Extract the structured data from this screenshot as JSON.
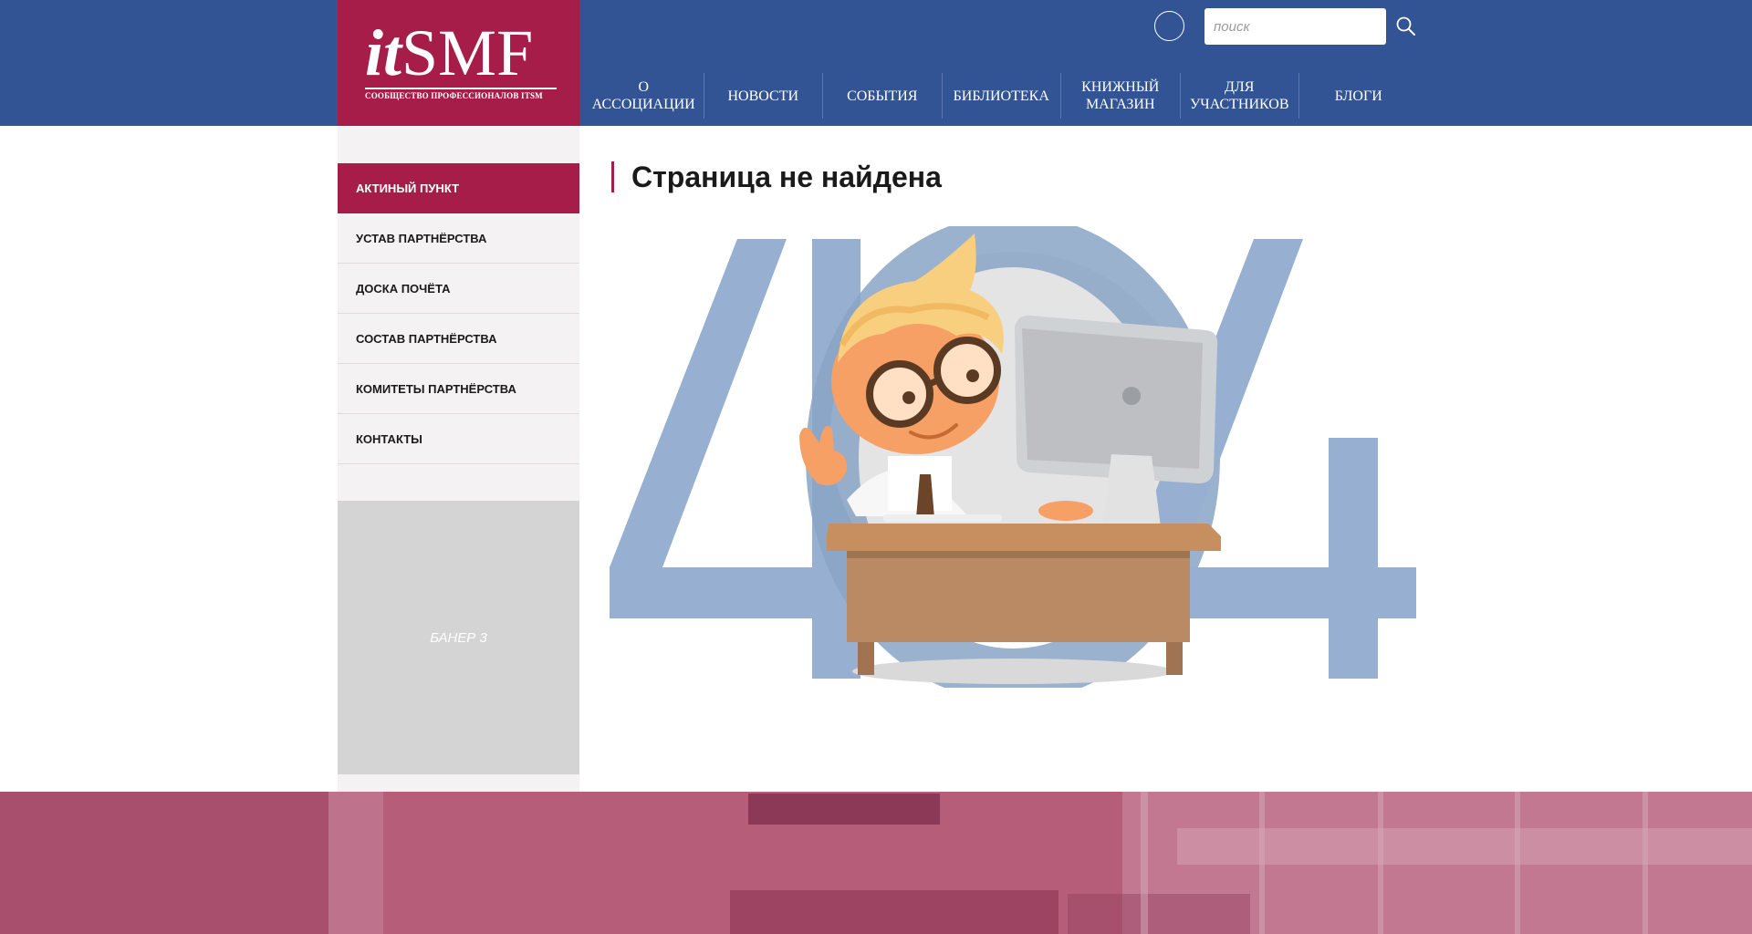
{
  "header": {
    "logo": {
      "wordmark_it": "it",
      "wordmark_smf": "SMF",
      "tagline": "СООБЩЕСТВО ПРОФЕССИОНАЛОВ ITSM"
    },
    "search": {
      "placeholder": "поиск",
      "value": ""
    },
    "nav": [
      {
        "label": "О\nАССОЦИАЦИИ"
      },
      {
        "label": "НОВОСТИ"
      },
      {
        "label": "СОБЫТИЯ"
      },
      {
        "label": "БИБЛИОТЕКА"
      },
      {
        "label": "КНИЖНЫЙ\nМАГАЗИН"
      },
      {
        "label": "ДЛЯ\nУЧАСТНИКОВ"
      },
      {
        "label": "БЛОГИ"
      }
    ]
  },
  "sidebar": {
    "items": [
      {
        "label": "АКТИНЫЙ ПУНКТ",
        "active": true
      },
      {
        "label": "УСТАВ ПАРТНЁРСТВА",
        "active": false
      },
      {
        "label": "ДОСКА ПОЧЁТА",
        "active": false
      },
      {
        "label": "СОСТАВ ПАРТНЁРСТВА",
        "active": false
      },
      {
        "label": "КОМИТЕТЫ ПАРТНЁРСТВА",
        "active": false
      },
      {
        "label": "КОНТАКТЫ",
        "active": false
      }
    ],
    "banner_label": "БАНЕР 3"
  },
  "main": {
    "title": "Страница не найдена"
  },
  "colors": {
    "header_bg": "#325494",
    "brand_accent": "#a61d4a",
    "sidebar_bg": "#f4f2f2",
    "banner_bg": "#d4d4d4",
    "digits": "#97b0d1"
  },
  "icons": {
    "circle_button": "circle-icon",
    "search": "search-icon",
    "illustration": "404-clerk-illustration"
  }
}
